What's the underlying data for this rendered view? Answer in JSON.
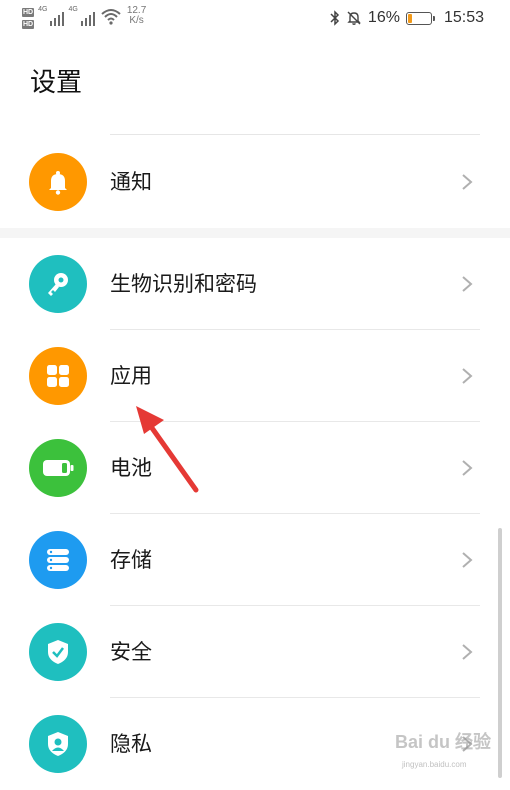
{
  "status_bar": {
    "hd_top": "HD",
    "hd_bottom": "HD",
    "sig1_label": "4G",
    "sig2_label": "4G",
    "speed_value": "12.7",
    "speed_unit": "K/s",
    "battery_percent": "16%",
    "battery_level": 0.16,
    "time": "15:53"
  },
  "page": {
    "title": "设置"
  },
  "settings_items": [
    {
      "label": "通知",
      "icon": "bell-icon",
      "color": "#ff9800"
    },
    {
      "label": "生物识别和密码",
      "icon": "key-icon",
      "color": "#1fbfbf"
    },
    {
      "label": "应用",
      "icon": "apps-grid-icon",
      "color": "#ff9800"
    },
    {
      "label": "电池",
      "icon": "battery-icon",
      "color": "#3cc13c"
    },
    {
      "label": "存储",
      "icon": "storage-icon",
      "color": "#1e9bf0"
    },
    {
      "label": "安全",
      "icon": "shield-check-icon",
      "color": "#1fbfbf"
    },
    {
      "label": "隐私",
      "icon": "privacy-shield-icon",
      "color": "#1fbfbf"
    }
  ],
  "watermark": {
    "text": "Bai du 经验",
    "sub": "jingyan.baidu.com"
  },
  "colors": {
    "annotation_arrow": "#e53935"
  }
}
